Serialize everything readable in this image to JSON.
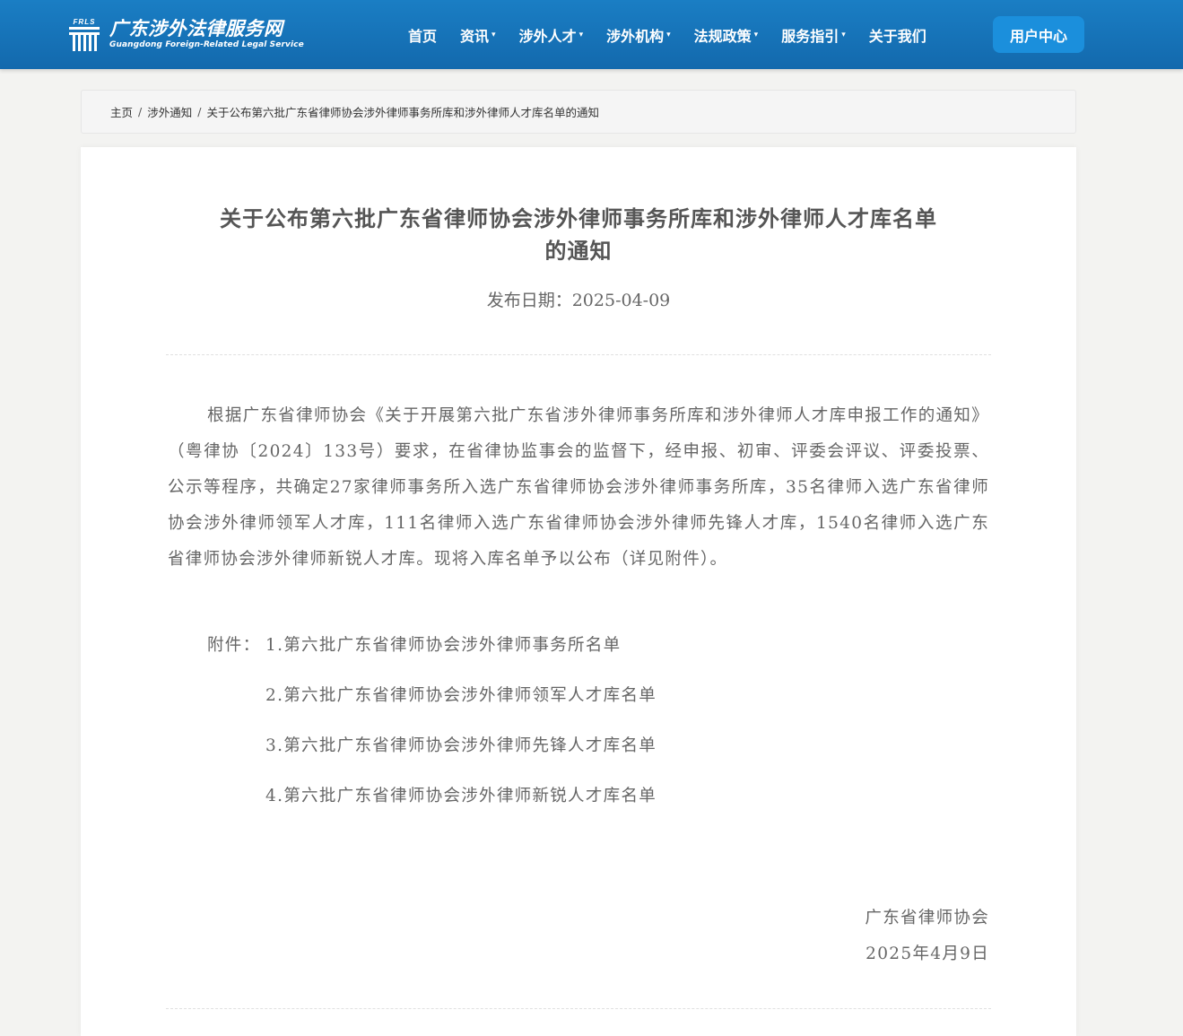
{
  "header": {
    "logo": {
      "mark_text": "FRLS",
      "name_cn": "广东涉外法律服务网",
      "name_en": "Guangdong Foreign-Related Legal Service"
    },
    "nav": [
      {
        "label": "首页",
        "dropdown": false
      },
      {
        "label": "资讯",
        "dropdown": true
      },
      {
        "label": "涉外人才",
        "dropdown": true
      },
      {
        "label": "涉外机构",
        "dropdown": true
      },
      {
        "label": "法规政策",
        "dropdown": true
      },
      {
        "label": "服务指引",
        "dropdown": true
      },
      {
        "label": "关于我们",
        "dropdown": false
      }
    ],
    "caret": "▾",
    "user_center": "用户中心",
    "colors": {
      "bar": "#1574b8",
      "button": "#1b8fdc"
    }
  },
  "breadcrumb": {
    "home": "主页",
    "section": "涉外通知",
    "current": "关于公布第六批广东省律师协会涉外律师事务所库和涉外律师人才库名单的通知",
    "separator": "/"
  },
  "article": {
    "title_line1": "关于公布第六批广东省律师协会涉外律师事务所库和涉外律师人才库名单",
    "title_line2": "的通知",
    "date": "发布日期：2025-04-09",
    "body": "根据广东省律师协会《关于开展第六批广东省涉外律师事务所库和涉外律师人才库申报工作的通知》（粤律协〔2024〕133号）要求，在省律协监事会的监督下，经申报、初审、评委会评议、评委投票、公示等程序，共确定27家律师事务所入选广东省律师协会涉外律师事务所库，35名律师入选广东省律师协会涉外律师领军人才库，111名律师入选广东省律师协会涉外律师先锋人才库，1540名律师入选广东省律师协会涉外律师新锐人才库。现将入库名单予以公布（详见附件）。",
    "attachments_label": "附件：",
    "attachments": [
      "1.第六批广东省律师协会涉外律师事务所名单",
      "2.第六批广东省律师协会涉外律师领军人才库名单",
      "3.第六批广东省律师协会涉外律师先锋人才库名单",
      "4.第六批广东省律师协会涉外律师新锐人才库名单"
    ],
    "signature_org": "广东省律师协会",
    "signature_date": "2025年4月9日"
  }
}
